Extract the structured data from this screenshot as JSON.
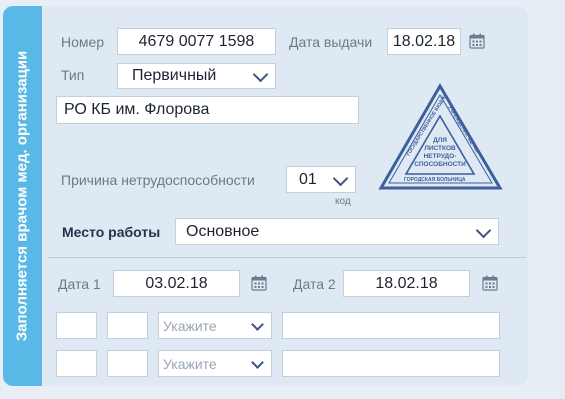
{
  "sidebar": {
    "title": "Заполняется врачом мед. организации"
  },
  "row_number": {
    "label": "Номер",
    "value": "4679 0077 1598"
  },
  "row_issue_date": {
    "label": "Дата выдачи",
    "value": "18.02.18",
    "icon": "calendar-icon"
  },
  "row_type": {
    "label": "Тип",
    "value": "Первичный"
  },
  "organization": {
    "value": "РО КБ им. Флорова"
  },
  "stamp": {
    "ring_text": "ГОСУДАРСТВЕННОЕ БЮДЖЕТНОЕ УЧРЕЖДЕНИЕ ЗДРАВООХРАНЕНИЯ ГОРОДСКАЯ БОЛЬНИЦА",
    "line1": "ДЛЯ",
    "line2": "ЛИСТКОВ",
    "line3": "НЕТРУДО-",
    "line4": "СПОСОБНОСТИ"
  },
  "incapacity": {
    "label": "Причина нетрудоспособности",
    "value": "01",
    "code_label": "код"
  },
  "workplace": {
    "label": "Место работы",
    "value": "Основное"
  },
  "date1": {
    "label": "Дата 1",
    "value": "03.02.18",
    "icon": "calendar-icon"
  },
  "date2": {
    "label": "Дата 2",
    "value": "18.02.18",
    "icon": "calendar-icon"
  },
  "grid": {
    "select_placeholder": "Укажите"
  },
  "colors": {
    "sidebar": "#5ab8e6",
    "panel": "#dfe9f4",
    "accent": "#3a5680"
  }
}
